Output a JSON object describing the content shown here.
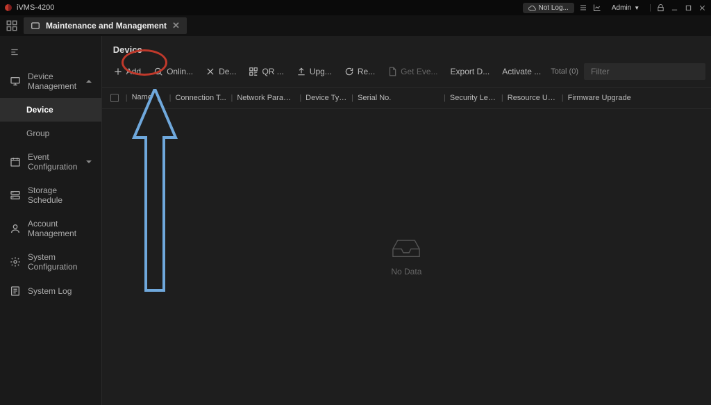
{
  "app_title": "iVMS-4200",
  "titlebar": {
    "not_logged": "Not Log...",
    "user": "Admin"
  },
  "tab": {
    "label": "Maintenance and Management"
  },
  "sidebar": {
    "items": [
      {
        "label": "Device Management",
        "icon": "monitor",
        "expandable": true,
        "state": "expanded"
      },
      {
        "label": "Event Configuration",
        "icon": "calendar",
        "expandable": true,
        "state": "collapsed"
      },
      {
        "label": "Storage Schedule",
        "icon": "storage",
        "expandable": false
      },
      {
        "label": "Account Management",
        "icon": "user",
        "expandable": false
      },
      {
        "label": "System Configuration",
        "icon": "gear",
        "expandable": false
      },
      {
        "label": "System Log",
        "icon": "log",
        "expandable": false
      }
    ],
    "sub": {
      "device": "Device",
      "group": "Group"
    }
  },
  "main": {
    "header": "Device",
    "toolbar": {
      "add": "Add",
      "online": "Onlin...",
      "delete": "De...",
      "qr": "QR ...",
      "upgrade": "Upg...",
      "refresh": "Re...",
      "get_events": "Get Eve...",
      "export": "Export D...",
      "activate": "Activate ...",
      "total_label": "Total",
      "total_count": "(0)",
      "filter_placeholder": "Filter"
    },
    "columns": {
      "name": "Name",
      "connection": "Connection T...",
      "network": "Network Param...",
      "device_type": "Device Type",
      "serial": "Serial No.",
      "security": "Security Level",
      "resource": "Resource Us...",
      "firmware": "Firmware Upgrade"
    },
    "empty": "No Data"
  }
}
